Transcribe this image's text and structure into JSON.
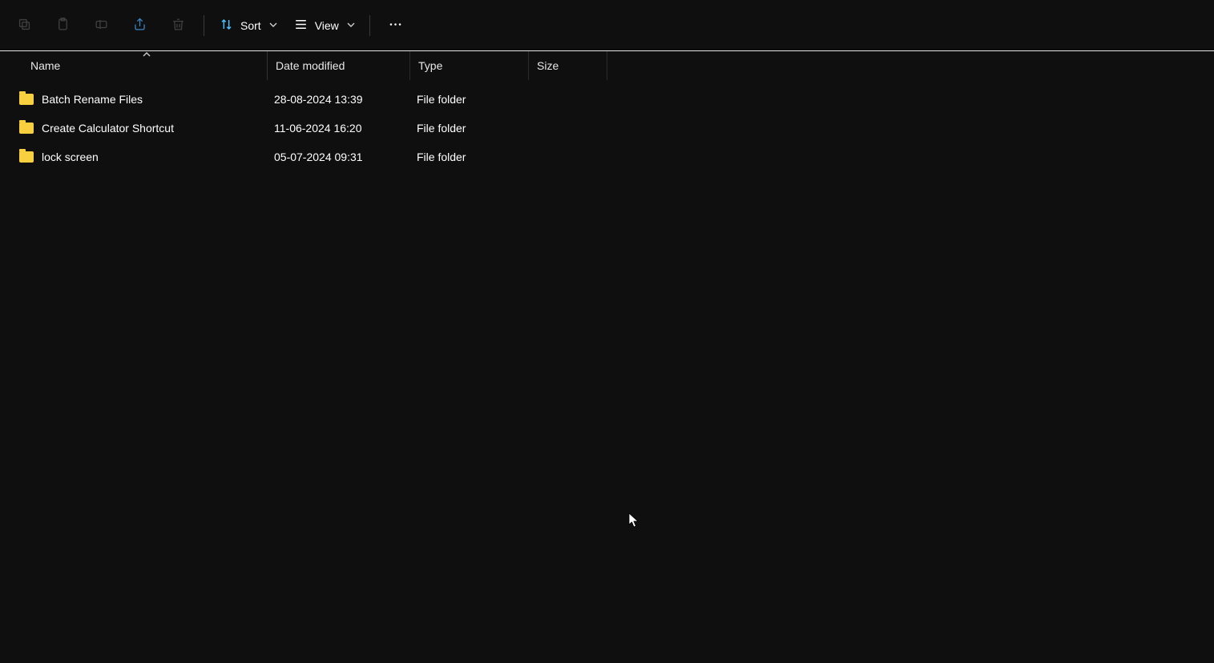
{
  "toolbar": {
    "sort_label": "Sort",
    "view_label": "View"
  },
  "headers": {
    "name": "Name",
    "date": "Date modified",
    "type": "Type",
    "size": "Size"
  },
  "rows": [
    {
      "name": "Batch Rename Files",
      "date": "28-08-2024 13:39",
      "type": "File folder",
      "size": ""
    },
    {
      "name": "Create Calculator Shortcut",
      "date": "11-06-2024 16:20",
      "type": "File folder",
      "size": ""
    },
    {
      "name": "lock screen",
      "date": "05-07-2024 09:31",
      "type": "File folder",
      "size": ""
    }
  ]
}
